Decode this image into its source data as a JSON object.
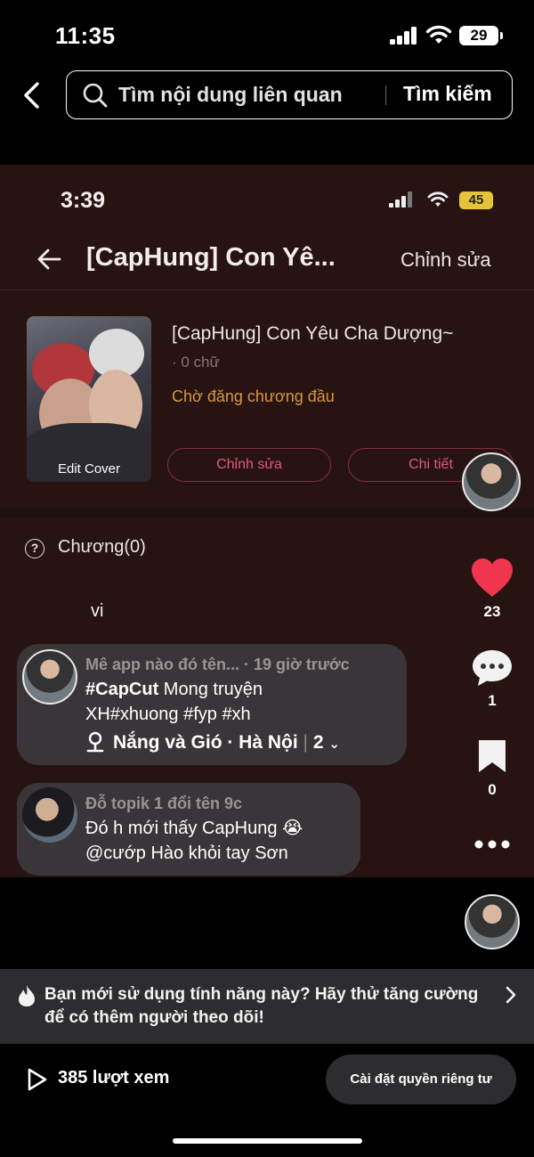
{
  "status_bar": {
    "time": "11:35",
    "battery": "29"
  },
  "search": {
    "placeholder": "Tìm nội dung liên quan",
    "button": "Tìm kiếm"
  },
  "embedded": {
    "status_time": "3:39",
    "battery": "45",
    "title": "[CapHung] Con Yê...",
    "edit_top": "Chỉnh sửa",
    "full_title": "[CapHung] Con Yêu Cha Dượng~",
    "words": "· 0 chữ",
    "pending": "Chờ đăng chương đầu",
    "cover_label": "Edit Cover",
    "pill_edit": "Chỉnh sửa",
    "pill_detail": "Chi tiết",
    "chapters": "Chương(0)",
    "caption": "vi"
  },
  "comments": [
    {
      "meta": "Mê app nào đó tên... · 19 giờ trước",
      "line1": "#CapCut Mong truyện",
      "line2": "XH#xhuong #fyp #xh",
      "location": "Nắng và Gió · Hà Nội",
      "count": "2"
    },
    {
      "meta": "Đỗ topik 1 đổi tên 9c",
      "line1": "Đó h mới thấy CapHung 😭",
      "line2": "@cướp Hào khỏi tay Sơn"
    }
  ],
  "rail": {
    "likes": "23",
    "comments": "1",
    "saves": "0"
  },
  "promo": {
    "text": "Bạn mới sử dụng tính năng này? Hãy thử tăng cường để có thêm người theo dõi!"
  },
  "footer": {
    "views": "385 lượt xem",
    "privacy": "Cài đặt quyền riêng tư"
  },
  "colors": {
    "like": "#f0364f",
    "accent_pink": "#e05a75",
    "pending": "#d7983e"
  }
}
